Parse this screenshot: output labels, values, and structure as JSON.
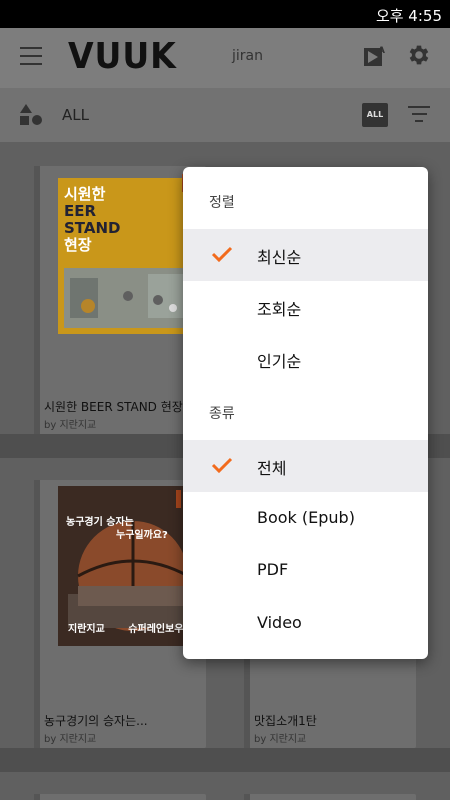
{
  "status_bar": {
    "time": "오후 4:55"
  },
  "app_bar": {
    "logo": "VUUK",
    "username": "jiran"
  },
  "filter_bar": {
    "category": "ALL",
    "badge": "ALL"
  },
  "books": [
    {
      "title": "시원한 BEER STAND 현장",
      "author": "by 지란지교",
      "cover_line1": "시원한",
      "cover_line2": "EER",
      "cover_line3": "STAND",
      "cover_line4": "현장"
    },
    {
      "title": "농구경기의 승자는...",
      "author": "by 지란지교",
      "cover_line1": "농구경기 승자는",
      "cover_line2": "누구일까요?",
      "cover_line3": "지란지교",
      "cover_line4": "슈퍼레인보우"
    },
    {
      "title": "맛집소개1탄",
      "author": "by 지란지교"
    }
  ],
  "popup": {
    "sort_title": "정렬",
    "sort_options": [
      {
        "label": "최신순",
        "selected": true
      },
      {
        "label": "조회순",
        "selected": false
      },
      {
        "label": "인기순",
        "selected": false
      }
    ],
    "type_title": "종류",
    "type_options": [
      {
        "label": "전체",
        "selected": true
      },
      {
        "label": "Book (Epub)",
        "selected": false
      },
      {
        "label": "PDF",
        "selected": false
      },
      {
        "label": "Video",
        "selected": false
      }
    ]
  },
  "colors": {
    "accent": "#f26b1d",
    "selected_row": "#ececef"
  }
}
